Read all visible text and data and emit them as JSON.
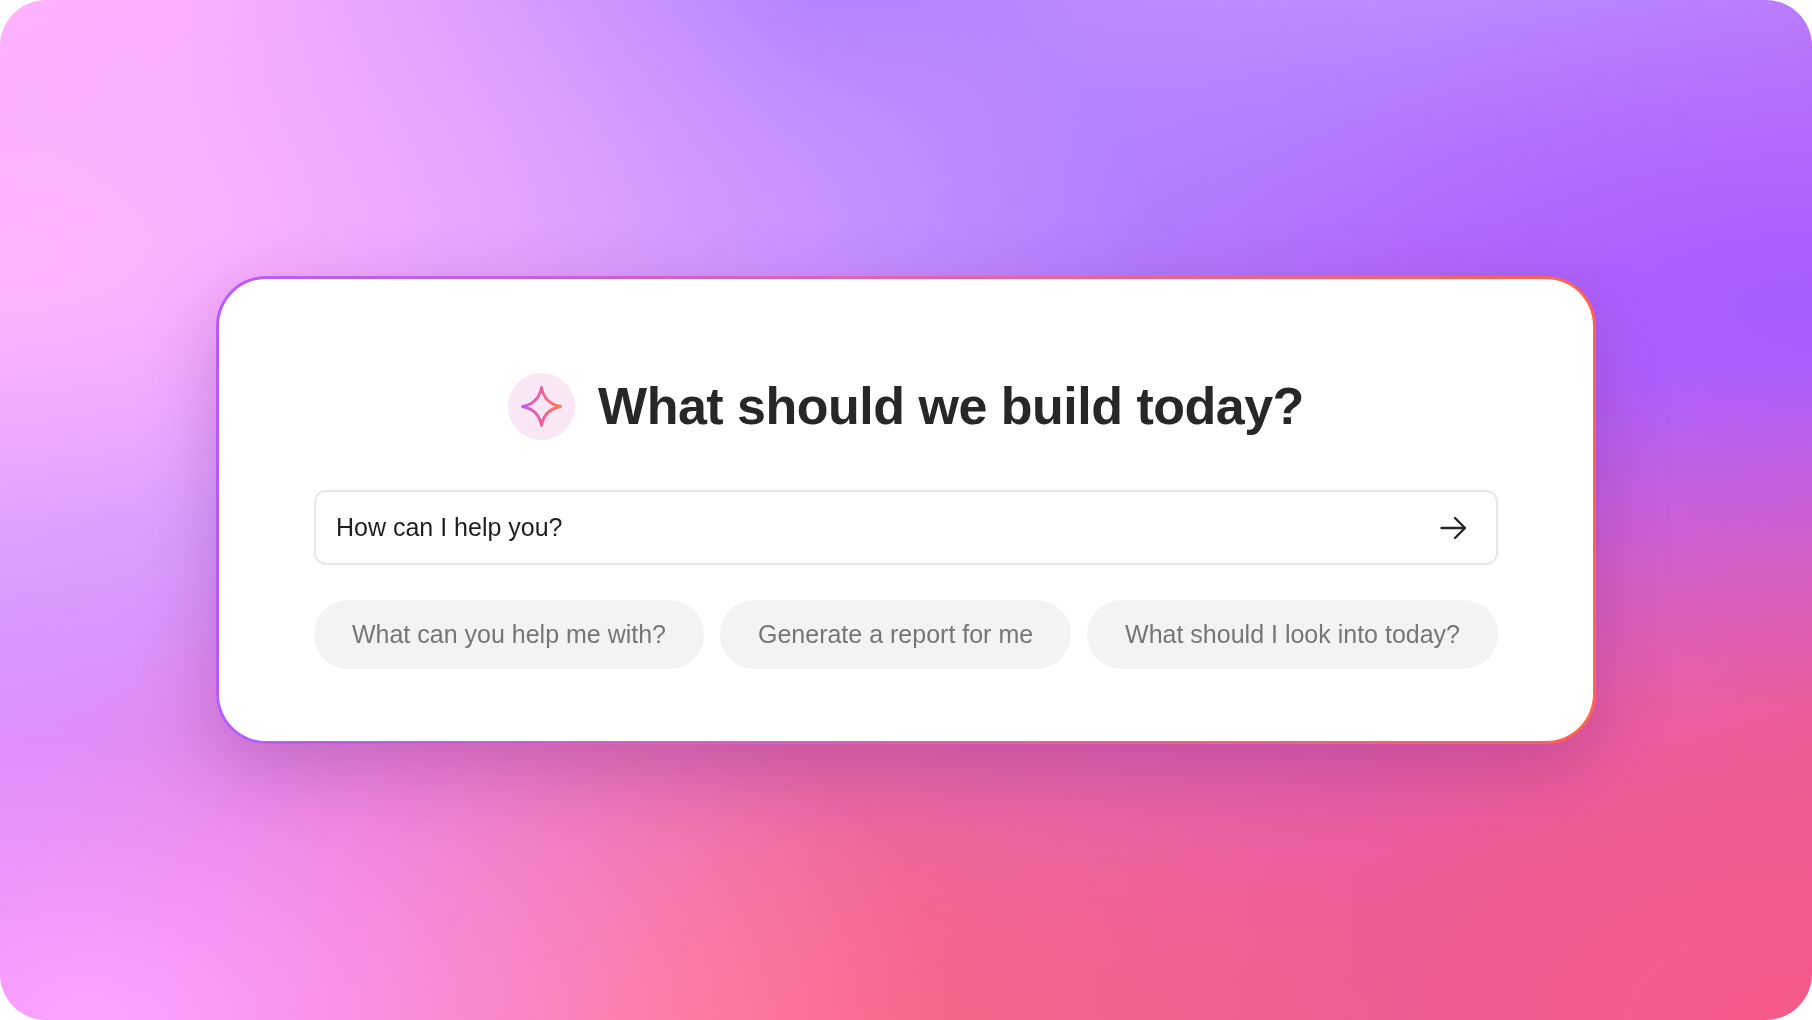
{
  "heading": {
    "title": "What should we build today?"
  },
  "prompt": {
    "placeholder": "How can I help you?"
  },
  "suggestions": [
    {
      "label": "What can you help me with?"
    },
    {
      "label": "Generate a report for me"
    },
    {
      "label": "What should I look into today?"
    }
  ]
}
